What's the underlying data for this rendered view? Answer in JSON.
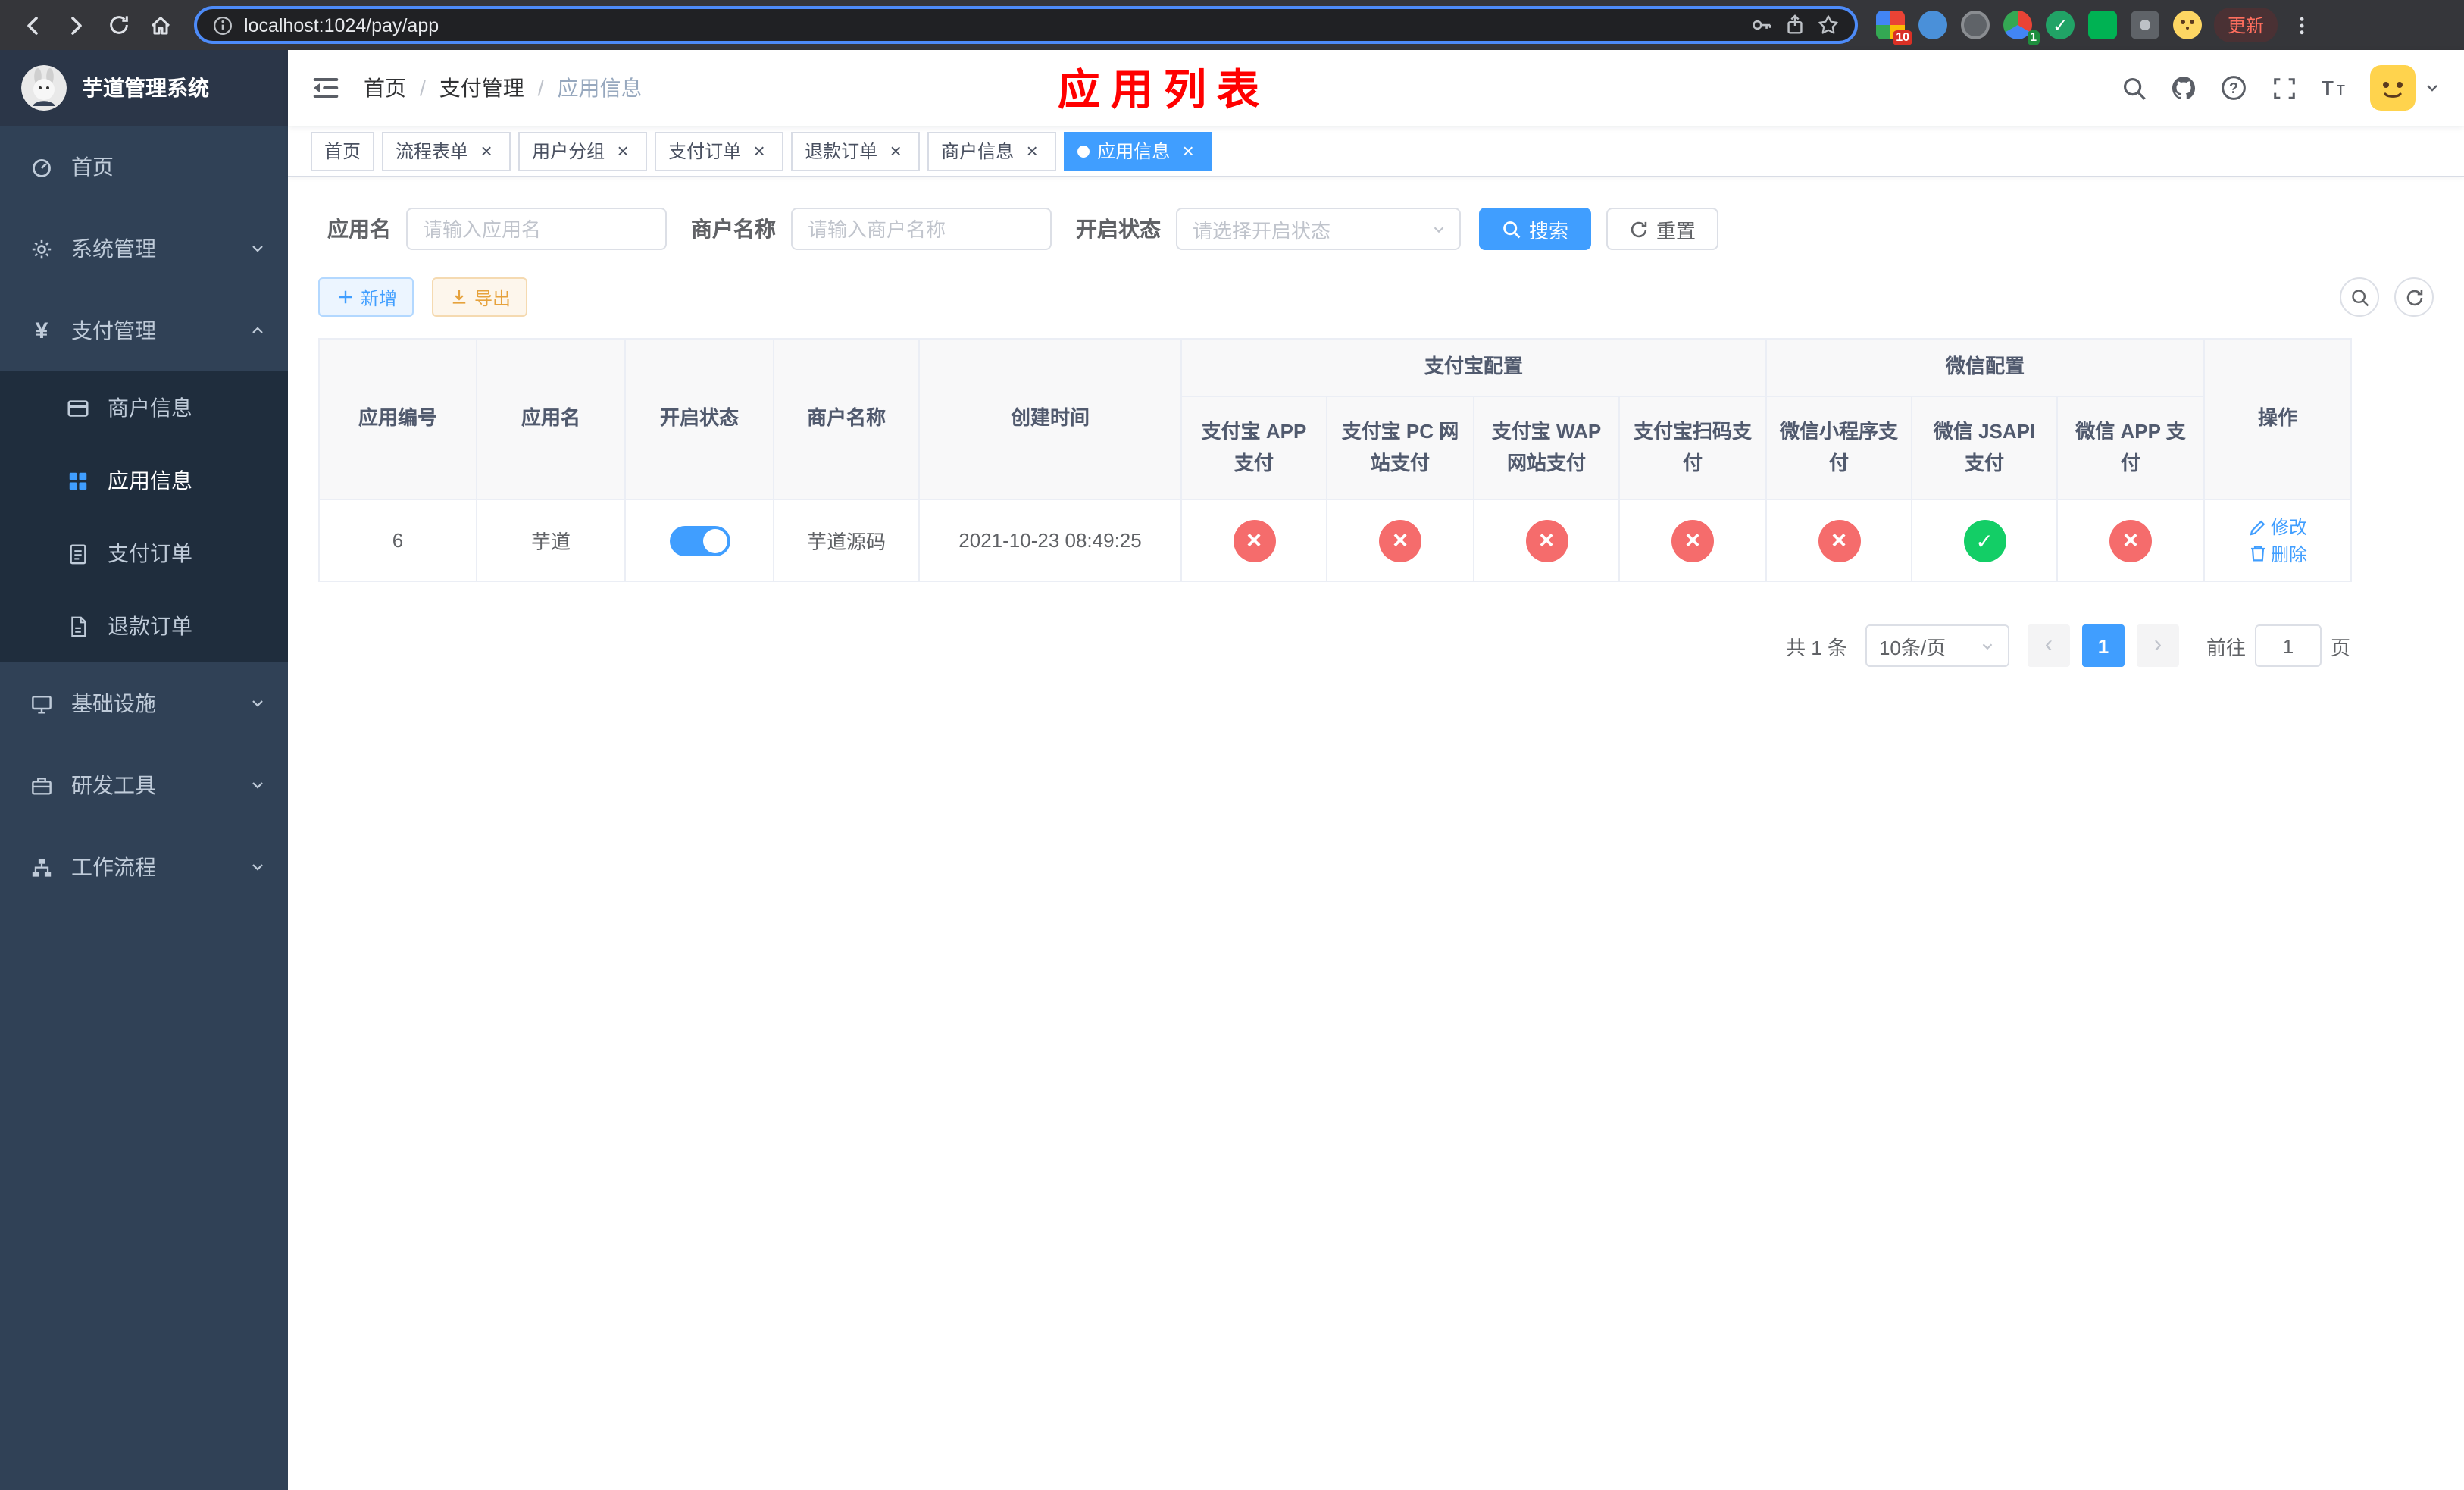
{
  "colors": {
    "accent": "#409eff",
    "danger": "#f56c6c",
    "success": "#13ce66",
    "warning": "#e6a23c",
    "page_title_red": "#ff0000",
    "sidebar_bg": "#304156",
    "submenu_bg": "#1f2d3d"
  },
  "browser": {
    "url": "localhost:1024/pay/app",
    "update_label": "更新",
    "adblock_badge": "10",
    "profile_badge": "1"
  },
  "sidebar": {
    "logo_title": "芋道管理系统",
    "menu": [
      {
        "label": "首页"
      },
      {
        "label": "系统管理"
      },
      {
        "label": "支付管理"
      },
      {
        "label": "基础设施"
      },
      {
        "label": "研发工具"
      },
      {
        "label": "工作流程"
      }
    ],
    "submenu_pay": [
      {
        "label": "商户信息"
      },
      {
        "label": "应用信息"
      },
      {
        "label": "支付订单"
      },
      {
        "label": "退款订单"
      }
    ]
  },
  "header": {
    "breadcrumb": [
      "首页",
      "支付管理",
      "应用信息"
    ],
    "page_title": "应用列表"
  },
  "tabs": [
    {
      "label": "首页",
      "closable": false,
      "active": false
    },
    {
      "label": "流程表单",
      "closable": true,
      "active": false
    },
    {
      "label": "用户分组",
      "closable": true,
      "active": false
    },
    {
      "label": "支付订单",
      "closable": true,
      "active": false
    },
    {
      "label": "退款订单",
      "closable": true,
      "active": false
    },
    {
      "label": "商户信息",
      "closable": true,
      "active": false
    },
    {
      "label": "应用信息",
      "closable": true,
      "active": true
    }
  ],
  "filters": {
    "app_name_label": "应用名",
    "app_name_placeholder": "请输入应用名",
    "merchant_label": "商户名称",
    "merchant_placeholder": "请输入商户名称",
    "status_label": "开启状态",
    "status_placeholder": "请选择开启状态",
    "search_label": "搜索",
    "reset_label": "重置"
  },
  "toolbar": {
    "add_label": "新增",
    "export_label": "导出"
  },
  "table": {
    "columns": {
      "app_id": "应用编号",
      "app_name": "应用名",
      "status": "开启状态",
      "merchant_name": "商户名称",
      "create_time": "创建时间",
      "alipay_group": "支付宝配置",
      "wechat_group": "微信配置",
      "alipay_app": "支付宝 APP 支付",
      "alipay_pc": "支付宝 PC 网站支付",
      "alipay_wap": "支付宝 WAP 网站支付",
      "alipay_qr": "支付宝扫码支付",
      "wx_lite": "微信小程序支付",
      "wx_jsapi": "微信 JSAPI 支付",
      "wx_app": "微信 APP 支付",
      "actions": "操作"
    },
    "rows": [
      {
        "app_id": "6",
        "app_name": "芋道",
        "status_on": true,
        "merchant_name": "芋道源码",
        "create_time": "2021-10-23 08:49:25",
        "configs": {
          "alipay_app": "no",
          "alipay_pc": "no",
          "alipay_wap": "no",
          "alipay_qr": "no",
          "wx_lite": "no",
          "wx_jsapi": "yes",
          "wx_app": "no"
        },
        "edit_label": "修改",
        "delete_label": "删除"
      }
    ]
  },
  "pagination": {
    "total_text": "共 1 条",
    "page_size_text": "10条/页",
    "current_page": "1",
    "goto_prefix": "前往",
    "goto_value": "1",
    "goto_suffix": "页"
  }
}
